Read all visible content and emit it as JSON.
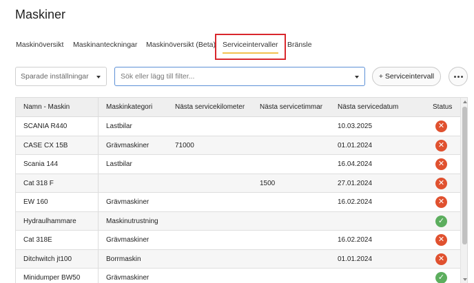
{
  "page": {
    "title": "Maskiner"
  },
  "tabs": [
    {
      "label": "Maskinöversikt",
      "active": false
    },
    {
      "label": "Maskinanteckningar",
      "active": false
    },
    {
      "label": "Maskinöversikt (Beta)",
      "active": false
    },
    {
      "label": "Serviceintervaller",
      "active": true
    },
    {
      "label": "Bränsle",
      "active": false
    }
  ],
  "toolbar": {
    "saved_settings": "Sparade inställningar",
    "search_placeholder": "Sök eller lägg till filter...",
    "add_button": "+ Serviceintervall",
    "more_icon": "more-horizontal-icon"
  },
  "table": {
    "columns": [
      "Namn - Maskin",
      "Maskinkategori",
      "Nästa servicekilometer",
      "Nästa servicetimmar",
      "Nästa servicedatum",
      "Status"
    ],
    "rows": [
      {
        "name": "SCANIA R440",
        "category": "Lastbilar",
        "km": "",
        "hours": "",
        "date": "10.03.2025",
        "status": "error"
      },
      {
        "name": "CASE CX 15B",
        "category": "Grävmaskiner",
        "km": "71000",
        "hours": "",
        "date": "01.01.2024",
        "status": "error"
      },
      {
        "name": "Scania 144",
        "category": "Lastbilar",
        "km": "",
        "hours": "",
        "date": "16.04.2024",
        "status": "error"
      },
      {
        "name": "Cat 318 F",
        "category": "",
        "km": "",
        "hours": "1500",
        "date": "27.01.2024",
        "status": "error"
      },
      {
        "name": "EW 160",
        "category": "Grävmaskiner",
        "km": "",
        "hours": "",
        "date": "16.02.2024",
        "status": "error"
      },
      {
        "name": "Hydraulhammare",
        "category": "Maskinutrustning",
        "km": "",
        "hours": "",
        "date": "",
        "status": "ok"
      },
      {
        "name": "Cat 318E",
        "category": "Grävmaskiner",
        "km": "",
        "hours": "",
        "date": "16.02.2024",
        "status": "error"
      },
      {
        "name": "Ditchwitch jt100",
        "category": "Borrmaskin",
        "km": "",
        "hours": "",
        "date": "01.01.2024",
        "status": "error"
      },
      {
        "name": "Minidumper BW50",
        "category": "Grävmaskiner",
        "km": "",
        "hours": "",
        "date": "",
        "status": "ok"
      }
    ]
  },
  "colors": {
    "error": "#e0512f",
    "ok": "#5cae5e",
    "active_tab_underline": "#f2c14e",
    "highlight_box": "#d9262c"
  }
}
